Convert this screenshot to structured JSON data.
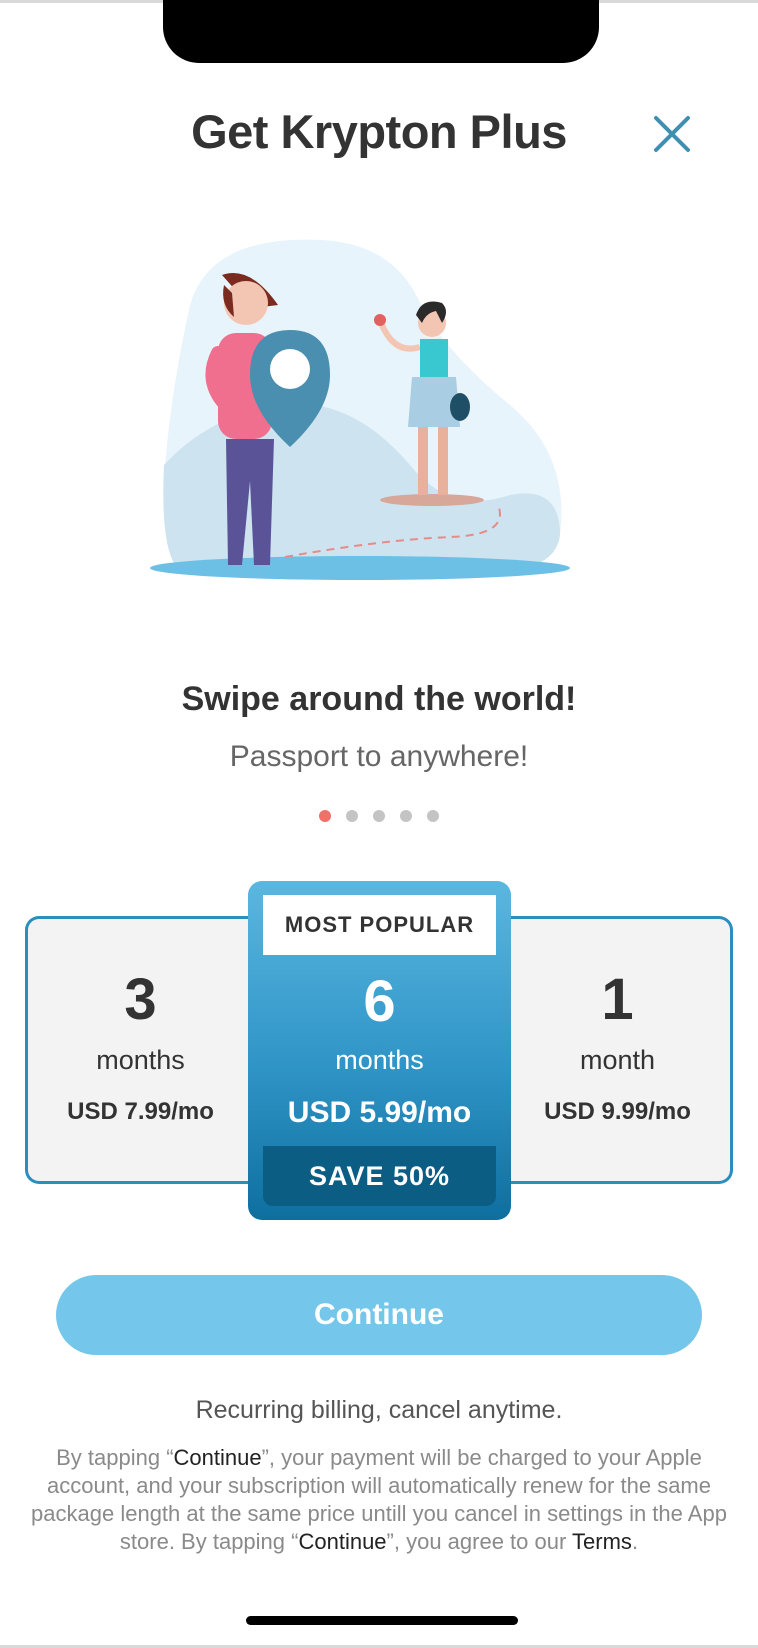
{
  "header": {
    "title": "Get Krypton Plus",
    "close_icon": "close-icon"
  },
  "hero": {
    "headline": "Swipe around the world!",
    "subline": "Passport to anywhere!",
    "page_dots": {
      "count": 5,
      "active": 1
    }
  },
  "plans": {
    "left": {
      "number": "3",
      "unit": "months",
      "price": "USD 7.99/mo"
    },
    "middle": {
      "badge": "MOST POPULAR",
      "number": "6",
      "unit": "months",
      "price": "USD 5.99/mo",
      "save": "SAVE 50%"
    },
    "right": {
      "number": "1",
      "unit": "month",
      "price": "USD 9.99/mo"
    }
  },
  "cta": {
    "continue_label": "Continue"
  },
  "footer": {
    "recurring": "Recurring billing, cancel anytime.",
    "legal": {
      "p1": "By tapping “",
      "continue1": "Continue",
      "p2": "”, your payment will be charged to your Apple account, and your subscription will automatically renew for the same package length at the same price untill you cancel in settings in the App store. By tapping “",
      "continue2": "Continue",
      "p3": "”, you agree to our ",
      "terms": "Terms",
      "p4": "."
    }
  },
  "colors": {
    "accent": "#74c7ea",
    "plan_border": "#2b8fbd",
    "save_bg": "#0b5d84",
    "dot_active": "#f0706a",
    "close_icon": "#3f8fb0"
  }
}
